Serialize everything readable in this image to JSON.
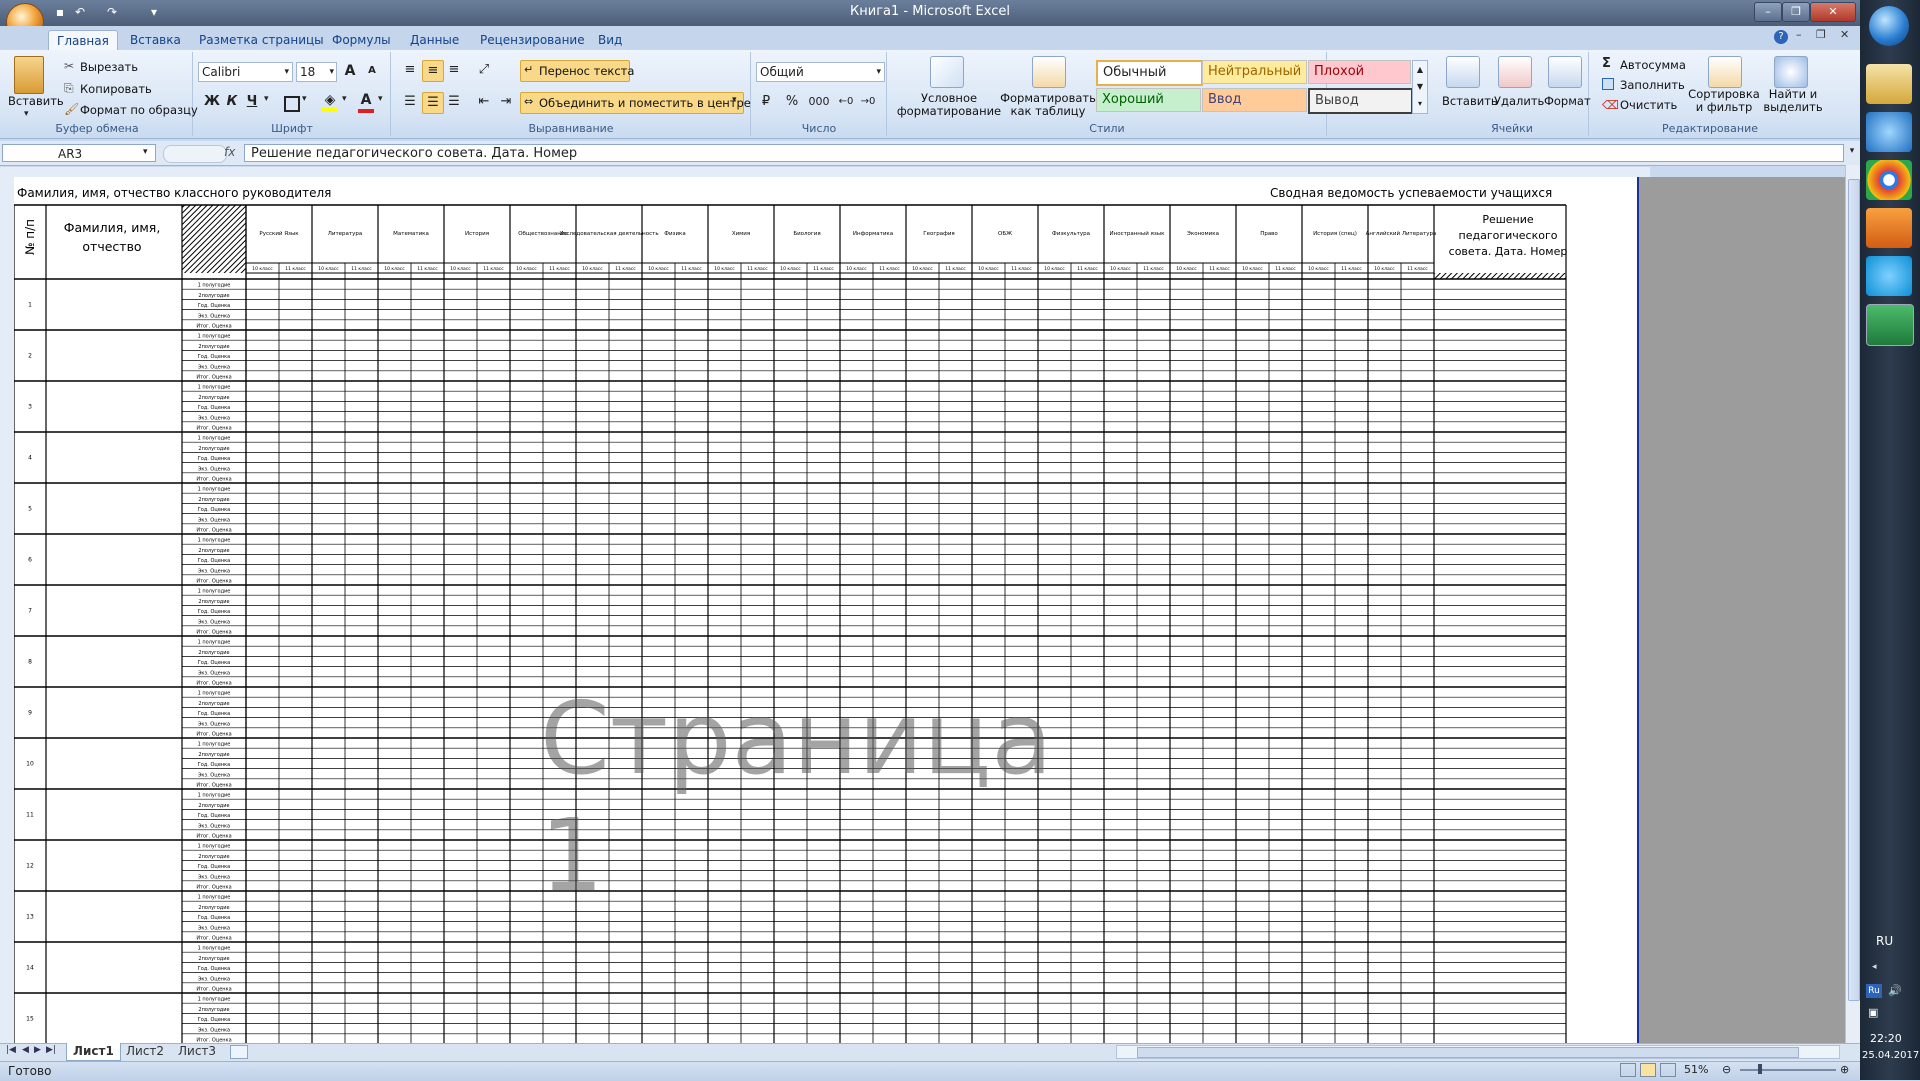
{
  "window": {
    "title": "Книга1 - Microsoft Excel"
  },
  "tabs": [
    "Главная",
    "Вставка",
    "Разметка страницы",
    "Формулы",
    "Данные",
    "Рецензирование",
    "Вид"
  ],
  "clipboard": {
    "paste": "Вставить",
    "cut": "Вырезать",
    "copy": "Копировать",
    "format_painter": "Формат по образцу",
    "label": "Буфер обмена"
  },
  "font": {
    "name": "Calibri",
    "size": "18",
    "bold": "Ж",
    "italic": "К",
    "underline": "Ч",
    "grow": "A",
    "shrink": "A",
    "font_color_letter": "A",
    "label": "Шрифт"
  },
  "alignment": {
    "wrap": "Перенос текста",
    "merge": "Объединить и поместить в центре",
    "label": "Выравнивание"
  },
  "number": {
    "format": "Общий",
    "percent": "%",
    "thousands": "000",
    "label": "Число"
  },
  "styles": {
    "conditional": "Условное форматирование",
    "as_table": "Форматировать как таблицу",
    "normal": "Обычный",
    "neutral": "Нейтральный",
    "bad": "Плохой",
    "good": "Хороший",
    "input": "Ввод",
    "output": "Вывод",
    "label": "Стили"
  },
  "cells": {
    "insert": "Вставить",
    "delete": "Удалить",
    "format": "Формат",
    "label": "Ячейки"
  },
  "editing": {
    "autosum": "Автосумма",
    "fill": "Заполнить",
    "clear": "Очистить",
    "sort": "Сортировка и фильтр",
    "find": "Найти и выделить",
    "label": "Редактирование"
  },
  "formula_bar": {
    "name_box": "AR3",
    "fx": "fx",
    "content": "Решение педагогического совета. Дата. Номер"
  },
  "sheet": {
    "title_left": "Фамилия, имя, отчество классного руководителя",
    "title_right": "Сводная ведомость успеваемости учащихся",
    "col_num": "№ п/п",
    "col_name": "Фамилия, имя, отчество",
    "decision": "Решение педагогического совета. Дата. Номер",
    "subjects": [
      "Русский Язык",
      "Литература",
      "Математика",
      "История",
      "Обществознание",
      "Исследовательская деятельность",
      "Физика",
      "Химия",
      "Биология",
      "Информатика",
      "География",
      "ОБЖ",
      "Физкультура",
      "Иностранный язык",
      "Экономика",
      "Право",
      "История (спец)",
      "Английский Литература"
    ],
    "grade_labels": [
      "10 класс",
      "11 класс"
    ],
    "period_labels": [
      "1 полугодие",
      "2полугодие",
      "Год. Оценка",
      "Экз. Оценка",
      "Итог. Оценка"
    ],
    "students": [
      "1",
      "2",
      "3",
      "4",
      "5",
      "6",
      "7",
      "8",
      "9",
      "10",
      "11",
      "12",
      "13",
      "14",
      "15"
    ],
    "watermark": "Страница 1"
  },
  "sheet_tabs": [
    "Лист1",
    "Лист2",
    "Лист3"
  ],
  "status": {
    "ready": "Готово",
    "zoom": "51%"
  },
  "taskbar": {
    "lang": "RU",
    "lang_small": "Ru",
    "time": "22:20",
    "date": "25.04.2017"
  }
}
